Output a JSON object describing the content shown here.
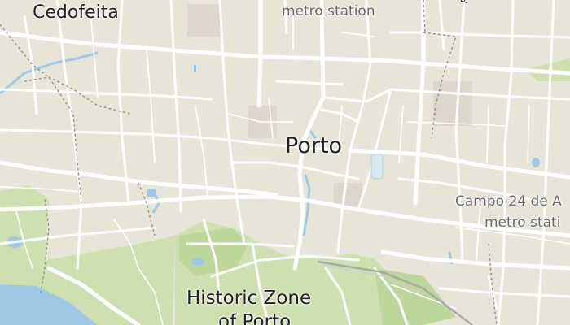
{
  "map": {
    "colors": {
      "land": "#e7e4d8",
      "park": "#cfe0b0",
      "park_dark": "#bcd79a",
      "water": "#9fc8e6",
      "road": "#ffffff",
      "rail": "#a9a9a9",
      "block": "#ddd6cc"
    },
    "labels": {
      "cedofeita": "Cedofeita",
      "metro_station_top": "metro station",
      "street_vertical": "R",
      "porto": "Porto",
      "campo_line1": "Campo 24 de A",
      "campo_line2": "metro stati",
      "historic_line1": "Historic Zone",
      "historic_line2": "of Porto"
    }
  }
}
